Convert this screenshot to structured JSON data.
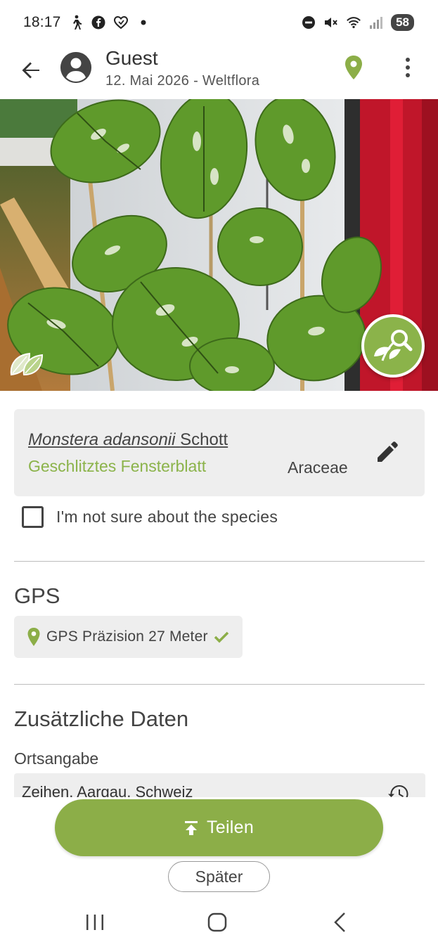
{
  "status_bar": {
    "time": "18:17",
    "battery": "58",
    "left_icons": [
      "walking-icon",
      "facebook-icon",
      "heart-icon",
      "dot-icon"
    ],
    "right_icons": [
      "do-not-disturb-icon",
      "mute-icon",
      "wifi-icon",
      "signal-icon"
    ]
  },
  "app_bar": {
    "title": "Guest",
    "subtitle": "12. Mai 2026 - Weltflora"
  },
  "species": {
    "genus_species": "Monstera adansonii",
    "author": "Schott",
    "common_name": "Geschlitztes Fensterblatt",
    "family": "Araceae"
  },
  "unsure": {
    "label": "I'm not sure about the species",
    "checked": false
  },
  "gps": {
    "section_title": "GPS",
    "precision_text": "GPS Präzision 27 Meter"
  },
  "additional": {
    "section_title": "Zusätzliche Daten",
    "location_label": "Ortsangabe",
    "location_value": "Zeihen, Aargau, Schweiz"
  },
  "actions": {
    "share_label": "Teilen",
    "later_label": "Später"
  },
  "colors": {
    "accent": "#8cae48",
    "common_name": "#8bb34a",
    "chip_bg": "#eeeeee"
  }
}
